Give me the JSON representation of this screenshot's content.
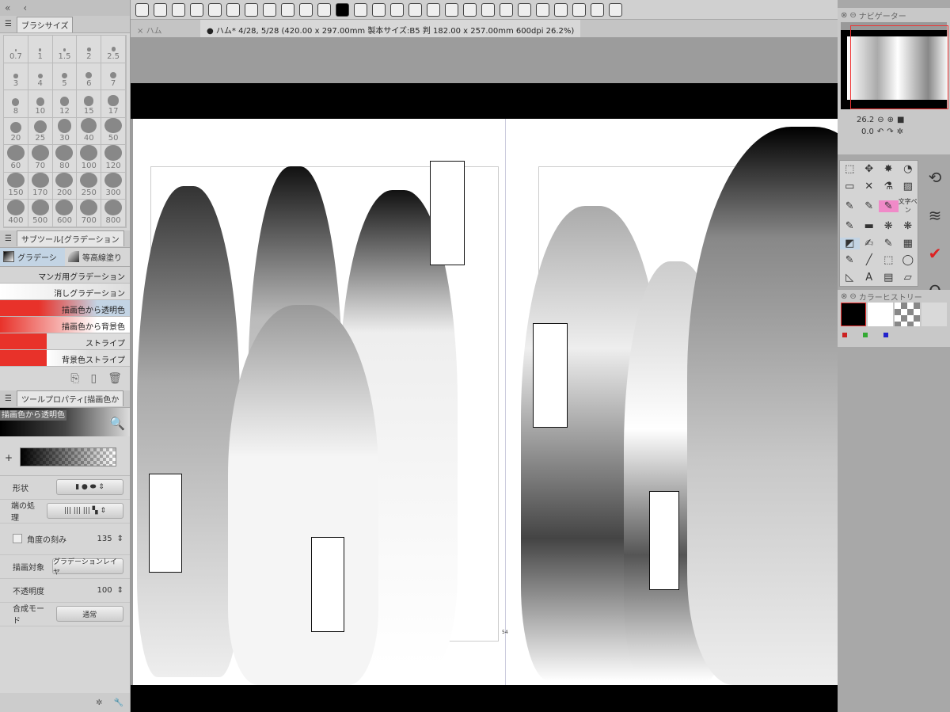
{
  "brush_size": {
    "tab": "ブラシサイズ",
    "sizes": [
      "0.7",
      "1",
      "1.5",
      "2",
      "2.5",
      "3",
      "4",
      "5",
      "6",
      "7",
      "8",
      "10",
      "12",
      "15",
      "17",
      "20",
      "25",
      "30",
      "40",
      "50",
      "60",
      "70",
      "80",
      "100",
      "120",
      "150",
      "170",
      "200",
      "250",
      "300",
      "400",
      "500",
      "600",
      "700",
      "800"
    ]
  },
  "subtool": {
    "tab": "サブツール[グラデーション",
    "groups": [
      "グラデーシ",
      "等高線塗り"
    ],
    "items": [
      "マンガ用グラデーション",
      "消しグラデーション",
      "描画色から透明色",
      "描画色から背景色",
      "ストライプ",
      "背景色ストライプ"
    ],
    "selected": "描画色から透明色"
  },
  "tool_property": {
    "tab": "ツールプロパティ[描画色か",
    "preset_name": "描画色から透明色",
    "shape_label": "形状",
    "edge_label": "端の処理",
    "angle_label": "角度の刻み",
    "angle_value": "135",
    "target_label": "描画対象",
    "target_value": "グラデーションレイヤ",
    "opacity_label": "不透明度",
    "opacity_value": "100",
    "blend_label": "合成モード",
    "blend_value": "通常"
  },
  "document": {
    "tab_inactive": "ハム",
    "tab_active": "ハム* 4/28, 5/28 (420.00 x 297.00mm 製本サイズ:B5 判 182.00 x 257.00mm 600dpi 26.2%)",
    "page_number": "54"
  },
  "navigator": {
    "title": "ナビゲーター",
    "zoom": "26.2",
    "rotation": "0.0"
  },
  "color_history": {
    "title": "カラーヒストリー",
    "colors": [
      "#000000",
      "#ffffff",
      "transparent",
      "#d9d9d9"
    ]
  },
  "tool_palette": {
    "text_pen_label": "文字ペン"
  },
  "colors": {
    "accent_red": "#e8322a",
    "selection": "#c3d4e4"
  }
}
